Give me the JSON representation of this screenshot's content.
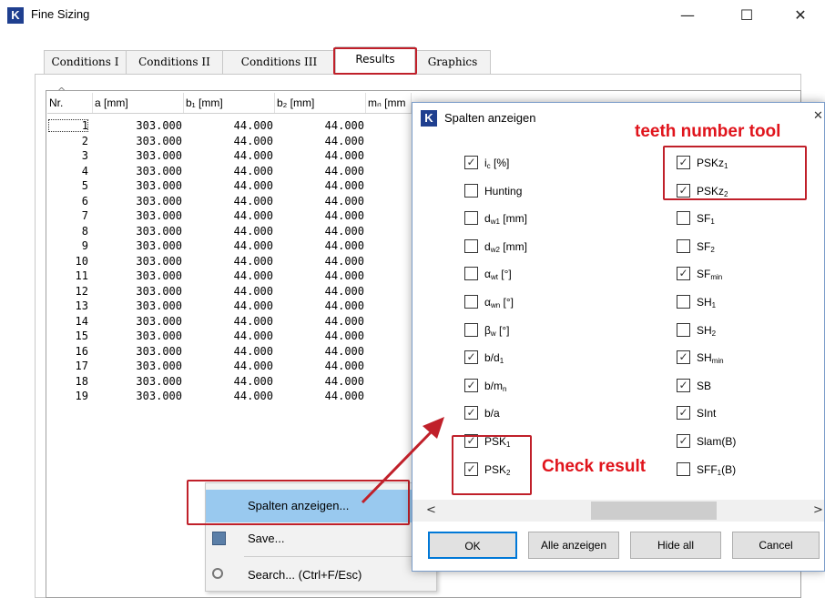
{
  "window": {
    "title": "Fine Sizing",
    "logo_letter": "K",
    "minimize_glyph": "—",
    "maximize_glyph": "☐",
    "close_glyph": "✕"
  },
  "tabs": [
    {
      "label": "Conditions I"
    },
    {
      "label": "Conditions II"
    },
    {
      "label": "Conditions III"
    },
    {
      "label": "Results",
      "selected": true
    },
    {
      "label": "Graphics"
    }
  ],
  "table": {
    "sort_glyph": "^",
    "columns": [
      "Nr.",
      "a [mm]",
      "b₁ [mm]",
      "b₂ [mm]",
      "mₙ [mm"
    ],
    "rows": [
      [
        "1",
        "303.000",
        "44.000",
        "44.000"
      ],
      [
        "2",
        "303.000",
        "44.000",
        "44.000"
      ],
      [
        "3",
        "303.000",
        "44.000",
        "44.000"
      ],
      [
        "4",
        "303.000",
        "44.000",
        "44.000"
      ],
      [
        "5",
        "303.000",
        "44.000",
        "44.000"
      ],
      [
        "6",
        "303.000",
        "44.000",
        "44.000"
      ],
      [
        "7",
        "303.000",
        "44.000",
        "44.000"
      ],
      [
        "8",
        "303.000",
        "44.000",
        "44.000"
      ],
      [
        "9",
        "303.000",
        "44.000",
        "44.000"
      ],
      [
        "10",
        "303.000",
        "44.000",
        "44.000"
      ],
      [
        "11",
        "303.000",
        "44.000",
        "44.000"
      ],
      [
        "12",
        "303.000",
        "44.000",
        "44.000"
      ],
      [
        "13",
        "303.000",
        "44.000",
        "44.000"
      ],
      [
        "14",
        "303.000",
        "44.000",
        "44.000"
      ],
      [
        "15",
        "303.000",
        "44.000",
        "44.000"
      ],
      [
        "16",
        "303.000",
        "44.000",
        "44.000"
      ],
      [
        "17",
        "303.000",
        "44.000",
        "44.000"
      ],
      [
        "18",
        "303.000",
        "44.000",
        "44.000"
      ],
      [
        "19",
        "303.000",
        "44.000",
        "44.000"
      ]
    ]
  },
  "context_menu": {
    "items": [
      {
        "label": "Spalten anzeigen...",
        "icon": "none",
        "highlighted": true
      },
      {
        "label": "Save...",
        "icon": "save-icon"
      },
      {
        "label": "Search... (Ctrl+F/Esc)",
        "icon": "search-icon"
      }
    ]
  },
  "dialog": {
    "title": "Spalten anzeigen",
    "logo_letter": "K",
    "close_glyph": "✕",
    "left_column": [
      {
        "label": "i",
        "sub": "c",
        "suffix": " [%]",
        "checked": true
      },
      {
        "label": "Hunting",
        "sub": "",
        "suffix": "",
        "checked": false
      },
      {
        "label": "d",
        "sub": "w1",
        "suffix": " [mm]",
        "checked": false
      },
      {
        "label": "d",
        "sub": "w2",
        "suffix": " [mm]",
        "checked": false
      },
      {
        "label": "α",
        "sub": "wt",
        "suffix": " [°]",
        "checked": false
      },
      {
        "label": "α",
        "sub": "wn",
        "suffix": " [°]",
        "checked": false
      },
      {
        "label": "β",
        "sub": "w",
        "suffix": " [°]",
        "checked": false
      },
      {
        "label": "b/d",
        "sub": "1",
        "suffix": "",
        "checked": true
      },
      {
        "label": "b/m",
        "sub": "n",
        "suffix": "",
        "checked": true
      },
      {
        "label": "b/a",
        "sub": "",
        "suffix": "",
        "checked": true
      },
      {
        "label": "PSK",
        "sub": "1",
        "suffix": "",
        "checked": true
      },
      {
        "label": "PSK",
        "sub": "2",
        "suffix": "",
        "checked": true
      }
    ],
    "right_column": [
      {
        "label": "PSKz",
        "sub": "1",
        "suffix": "",
        "checked": true
      },
      {
        "label": "PSKz",
        "sub": "2",
        "suffix": "",
        "checked": true
      },
      {
        "label": "SF",
        "sub": "1",
        "suffix": "",
        "checked": false
      },
      {
        "label": "SF",
        "sub": "2",
        "suffix": "",
        "checked": false
      },
      {
        "label": "SF",
        "sub": "min",
        "suffix": "",
        "checked": true
      },
      {
        "label": "SH",
        "sub": "1",
        "suffix": "",
        "checked": false
      },
      {
        "label": "SH",
        "sub": "2",
        "suffix": "",
        "checked": false
      },
      {
        "label": "SH",
        "sub": "min",
        "suffix": "",
        "checked": true
      },
      {
        "label": "SB",
        "sub": "",
        "suffix": "",
        "checked": true
      },
      {
        "label": "SInt",
        "sub": "",
        "suffix": "",
        "checked": true
      },
      {
        "label": "Slam(B)",
        "sub": "",
        "suffix": "",
        "checked": true
      },
      {
        "label": "SFF",
        "sub": "1",
        "suffix": "(B)",
        "checked": false
      }
    ],
    "scroll_left_glyph": "<",
    "scroll_right_glyph": ">",
    "buttons": {
      "ok": "OK",
      "show_all": "Alle anzeigen",
      "hide_all": "Hide all",
      "cancel": "Cancel"
    }
  },
  "annotations": {
    "teeth_tool": "teeth number tool",
    "check_result": "Check result",
    "color": "#e0141c"
  }
}
